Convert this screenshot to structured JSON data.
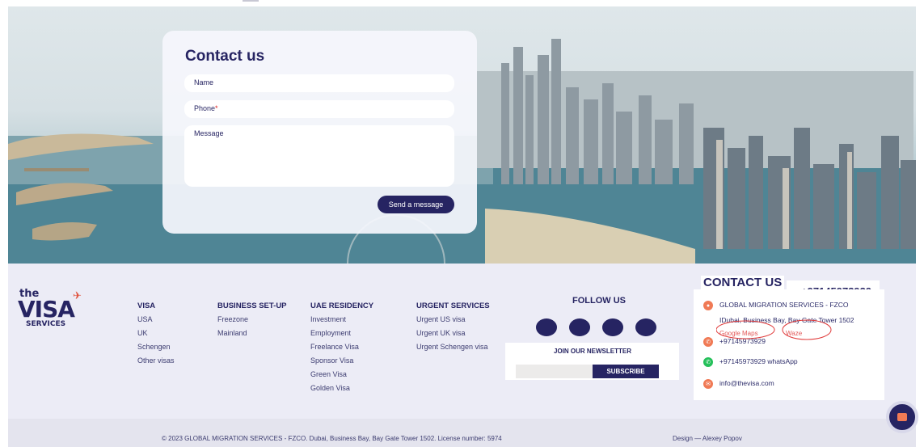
{
  "contact_form": {
    "title": "Contact us",
    "name_placeholder": "Name",
    "phone_placeholder": "Phone",
    "phone_required_mark": "*",
    "message_placeholder": "Message",
    "send_label": "Send a message"
  },
  "logo": {
    "line1": "the",
    "line2": "VISA",
    "line3": "SERVICES"
  },
  "footer_columns": [
    {
      "heading": "VISA",
      "items": [
        "USA",
        "UK",
        "Schengen",
        "Other visas"
      ]
    },
    {
      "heading": "BUSINESS SET-UP",
      "items": [
        "Freezone",
        "Mainland"
      ]
    },
    {
      "heading": "UAE RESIDENCY",
      "items": [
        "Investment",
        "Employment",
        "Freelance Visa",
        "Sponsor Visa",
        "Green Visa",
        "Golden Visa"
      ]
    },
    {
      "heading": "URGENT SERVICES",
      "items": [
        "Urgent US visa",
        "Urgent UK visa",
        "Urgent Schengen visa"
      ]
    }
  ],
  "follow_us": {
    "title": "FOLLOW US"
  },
  "newsletter": {
    "title": "JOIN OUR NEWSLETTER",
    "button": "SUBSCRIBE"
  },
  "contact_info": {
    "title": "CONTACT US",
    "company": "GLOBAL MIGRATION SERVICES - FZCO",
    "address": "IDubai, Business Bay, Bay Gate Tower 1502",
    "google_maps": "Google Maps",
    "waze": "Waze",
    "phone": "+97145973929",
    "whatsapp": "+97145973929 whatsApp",
    "email": "info@thevisa.com"
  },
  "bottom": {
    "copyright": "© 2023 GLOBAL MIGRATION SERVICES - FZCO. Dubai, Business Bay, Bay Gate Tower 1502. License number: 5974",
    "design": "Design — Alexey Popov"
  },
  "colors": {
    "brand": "#262462",
    "accent": "#f07a55",
    "whatsapp": "#25c05a"
  }
}
